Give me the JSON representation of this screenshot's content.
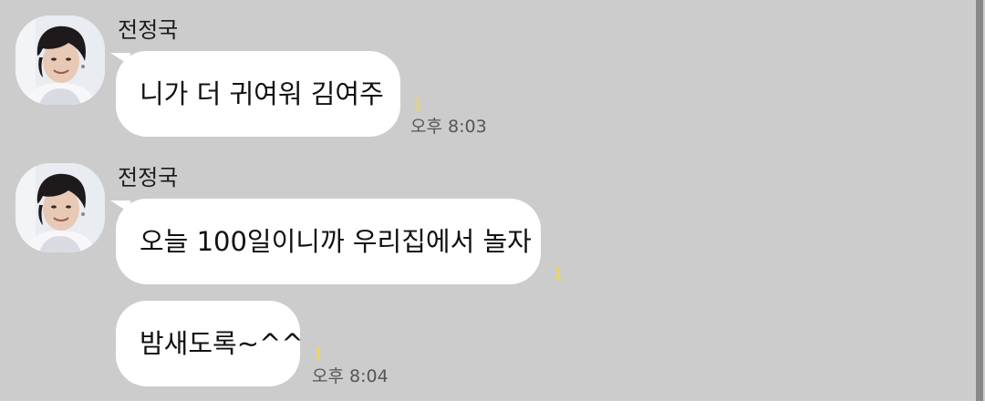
{
  "chat": {
    "messages": [
      {
        "sender": "전정국",
        "text": "니가 더 귀여워 김여주",
        "unread": "1",
        "time": "오후 8:03"
      },
      {
        "sender": "전정국",
        "text": "오늘 100일이니까 우리집에서 놀자",
        "unread": "1",
        "time": ""
      },
      {
        "sender": "",
        "text": "밤새도록~^^",
        "unread": "1",
        "time": "오후 8:04"
      }
    ]
  },
  "colors": {
    "background": "#cccccc",
    "bubble": "#ffffff",
    "unread": "#f2d84a",
    "time": "#555555"
  }
}
